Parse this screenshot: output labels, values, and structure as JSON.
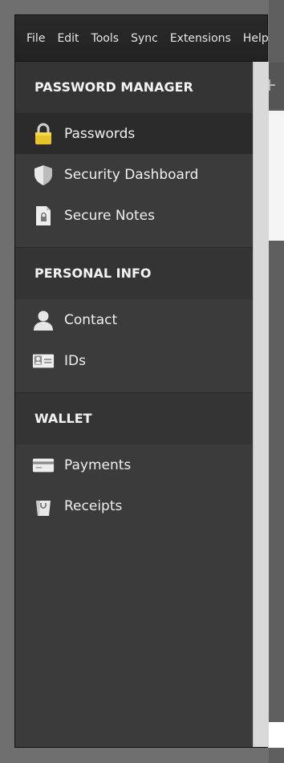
{
  "menubar": {
    "items": [
      "File",
      "Edit",
      "Tools",
      "Sync",
      "Extensions",
      "Help"
    ]
  },
  "sidebar": {
    "sections": [
      {
        "title": "PASSWORD MANAGER",
        "items": [
          {
            "label": "Passwords",
            "icon": "padlock-icon",
            "active": true
          },
          {
            "label": "Security Dashboard",
            "icon": "shield-icon"
          },
          {
            "label": "Secure Notes",
            "icon": "secure-note-icon"
          }
        ]
      },
      {
        "title": "PERSONAL INFO",
        "items": [
          {
            "label": "Contact",
            "icon": "person-icon"
          },
          {
            "label": "IDs",
            "icon": "id-card-icon"
          }
        ]
      },
      {
        "title": "WALLET",
        "items": [
          {
            "label": "Payments",
            "icon": "credit-card-icon"
          },
          {
            "label": "Receipts",
            "icon": "shopping-bag-icon"
          }
        ]
      }
    ]
  },
  "toolbar": {
    "add_label": "+"
  },
  "colors": {
    "sidebar_bg": "#3b3b3b",
    "active_item_bg": "#2b2b2b",
    "padlock": "#e6c42a"
  }
}
